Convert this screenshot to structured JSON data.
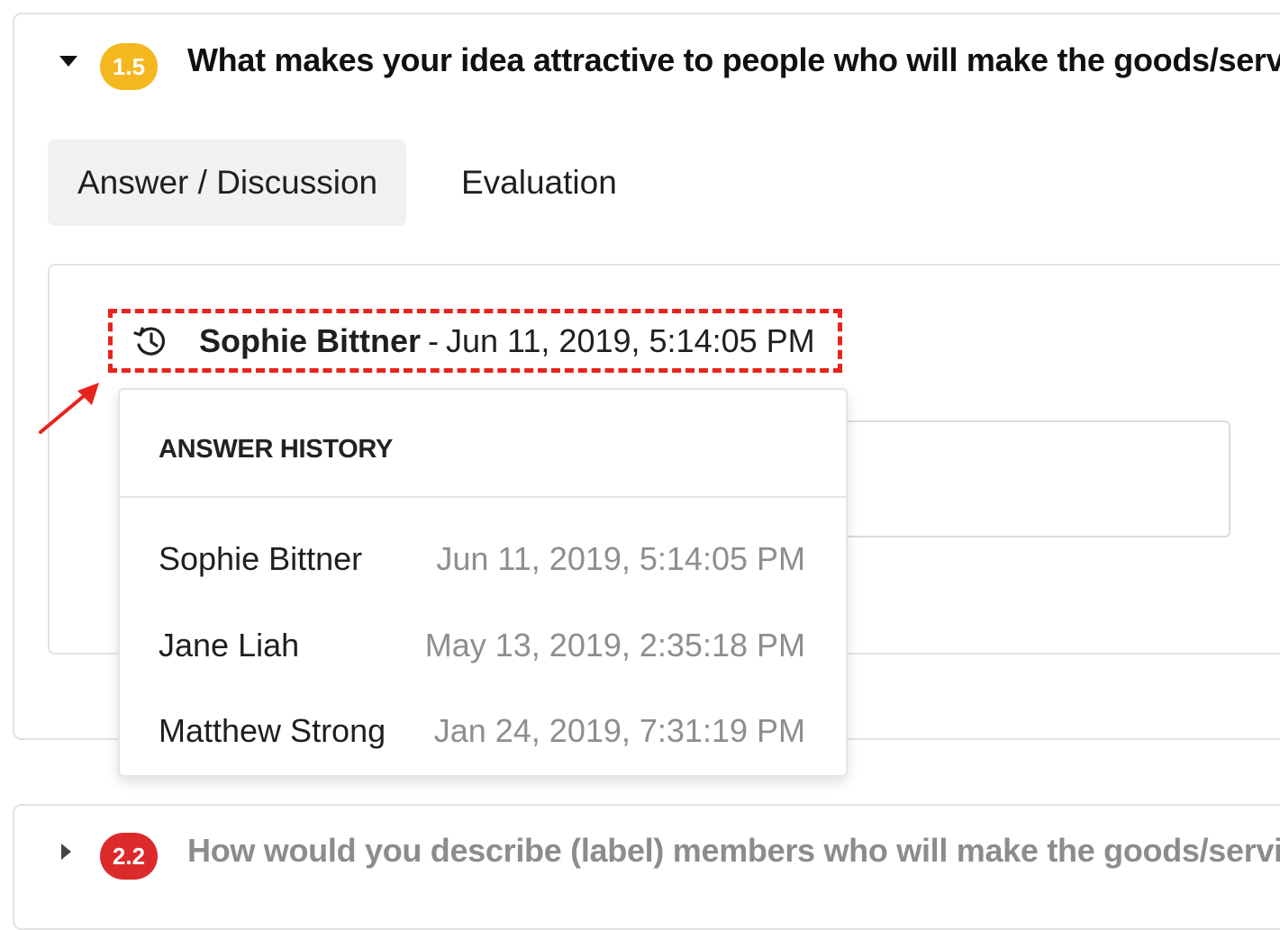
{
  "questions": [
    {
      "number": "1.5",
      "title": "What makes your idea attractive to people who will make the goods/serv",
      "expanded": true,
      "badge_color": "#f5b71f"
    },
    {
      "number": "2.2",
      "title": "How would you describe (label) members who will make the goods/servic",
      "expanded": false,
      "badge_color": "#dc2a2a"
    }
  ],
  "tabs": [
    {
      "label": "Answer / Discussion",
      "active": true
    },
    {
      "label": "Evaluation",
      "active": false
    }
  ],
  "current_answer": {
    "icon": "history-icon",
    "user": "Sophie Bittner",
    "separator": "-",
    "date": "Jun 11, 2019, 5:14:05 PM"
  },
  "answer_history": {
    "header": "ANSWER HISTORY",
    "entries": [
      {
        "user": "Sophie Bittner",
        "date": "Jun 11, 2019, 5:14:05 PM"
      },
      {
        "user": "Jane Liah",
        "date": "May 13, 2019, 2:35:18 PM"
      },
      {
        "user": "Matthew Strong",
        "date": "Jan 24, 2019, 7:31:19 PM"
      }
    ]
  },
  "colors": {
    "highlight": "#e8231b",
    "muted_text": "#8e8e8e",
    "active_tab_bg": "#f1f1f1"
  }
}
